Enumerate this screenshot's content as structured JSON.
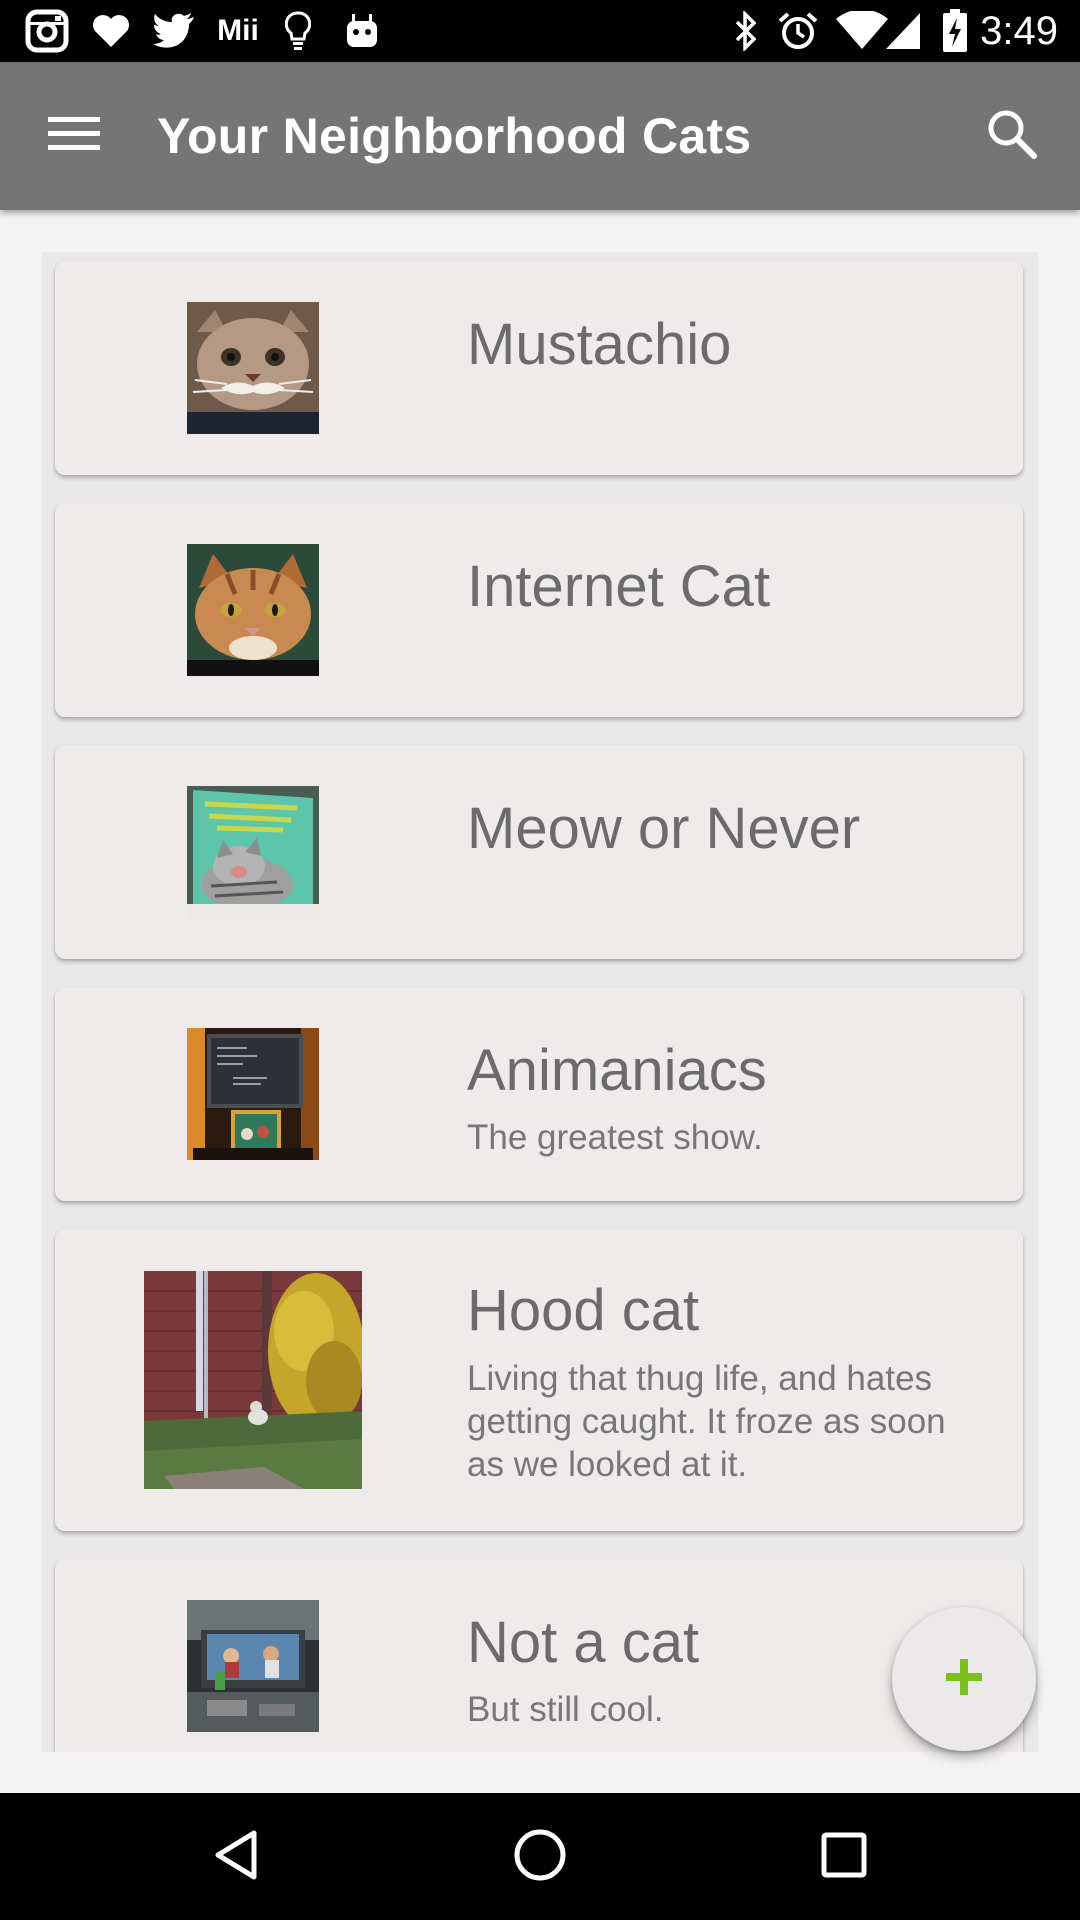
{
  "status_bar": {
    "time": "3:49",
    "left_icons": [
      "instagram-icon",
      "heart-icon",
      "twitter-icon",
      "mii-icon",
      "lightbulb-icon",
      "android-icon"
    ],
    "mii_label": "Mii",
    "right_icons": [
      "bluetooth-icon",
      "alarm-icon",
      "wifi-icon",
      "signal-icon",
      "battery-charging-icon"
    ]
  },
  "app_bar": {
    "title": "Your Neighborhood Cats",
    "menu_icon": "hamburger-menu-icon",
    "search_icon": "search-icon",
    "color": "#757575"
  },
  "cats": [
    {
      "name": "Mustachio",
      "description": "",
      "image": "cat-with-mustache-photo"
    },
    {
      "name": "Internet Cat",
      "description": "",
      "image": "orange-tabby-cat-photo"
    },
    {
      "name": "Meow or Never",
      "description": "",
      "image": "book-cover-yawning-kitten-photo"
    },
    {
      "name": "Animaniacs",
      "description": "The greatest show.",
      "image": "tv-screen-animaniacs-photo"
    },
    {
      "name": "Hood cat",
      "description": "Living that thug life, and hates getting caught. It froze as soon as we looked at it.",
      "image": "cat-beside-brick-house-photo"
    },
    {
      "name": "Not a cat",
      "description": "But still cool.",
      "image": "living-room-tv-photo"
    }
  ],
  "fab": {
    "icon": "plus-icon",
    "accent": "#7cc01a"
  },
  "nav_bar": {
    "back_icon": "back-triangle-icon",
    "home_icon": "home-circle-icon",
    "recents_icon": "recents-square-icon"
  }
}
